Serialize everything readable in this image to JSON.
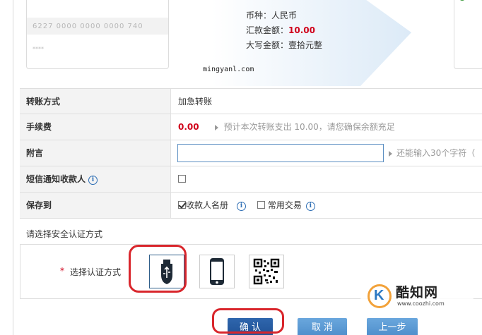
{
  "summary": {
    "currency_line": "币种：人民币",
    "amount_label": "汇款金额：",
    "amount_value": "10.00",
    "capital_line": "大写金额：壹拾元整",
    "card_number_blurred": "6227 0000 0000 0000 740",
    "card_name_blurred": "****",
    "watermark_text": "mingyanl.com"
  },
  "form": {
    "transfer_method": {
      "label": "转账方式",
      "value": "加急转账"
    },
    "fee": {
      "label": "手续费",
      "value": "0.00",
      "hint": "预计本次转账支出 10.00，请您确保余额充足"
    },
    "message": {
      "label": "附言",
      "value": "",
      "hint": "还能输入30个字符（"
    },
    "sms_notify": {
      "label": "短信通知收款人",
      "checked": false
    },
    "save_to": {
      "label": "保存到",
      "option1": "收款人名册",
      "option1_checked": true,
      "option2": "常用交易",
      "option2_checked": false
    }
  },
  "auth": {
    "section_title": "请选择安全认证方式",
    "select_label": "选择认证方式",
    "options": [
      "usb-key",
      "mobile-phone",
      "qr-code"
    ],
    "selected": "usb-key"
  },
  "buttons": {
    "confirm": "确 认",
    "cancel": "取 消",
    "back": "上一步"
  },
  "logo": {
    "name": "酷知网",
    "url": "www.coozhi.com"
  },
  "colors": {
    "accent_red": "#d0021b",
    "primary_blue": "#1d4e92",
    "button_blue": "#4a8ac8",
    "highlight_ring": "#d9262c"
  }
}
